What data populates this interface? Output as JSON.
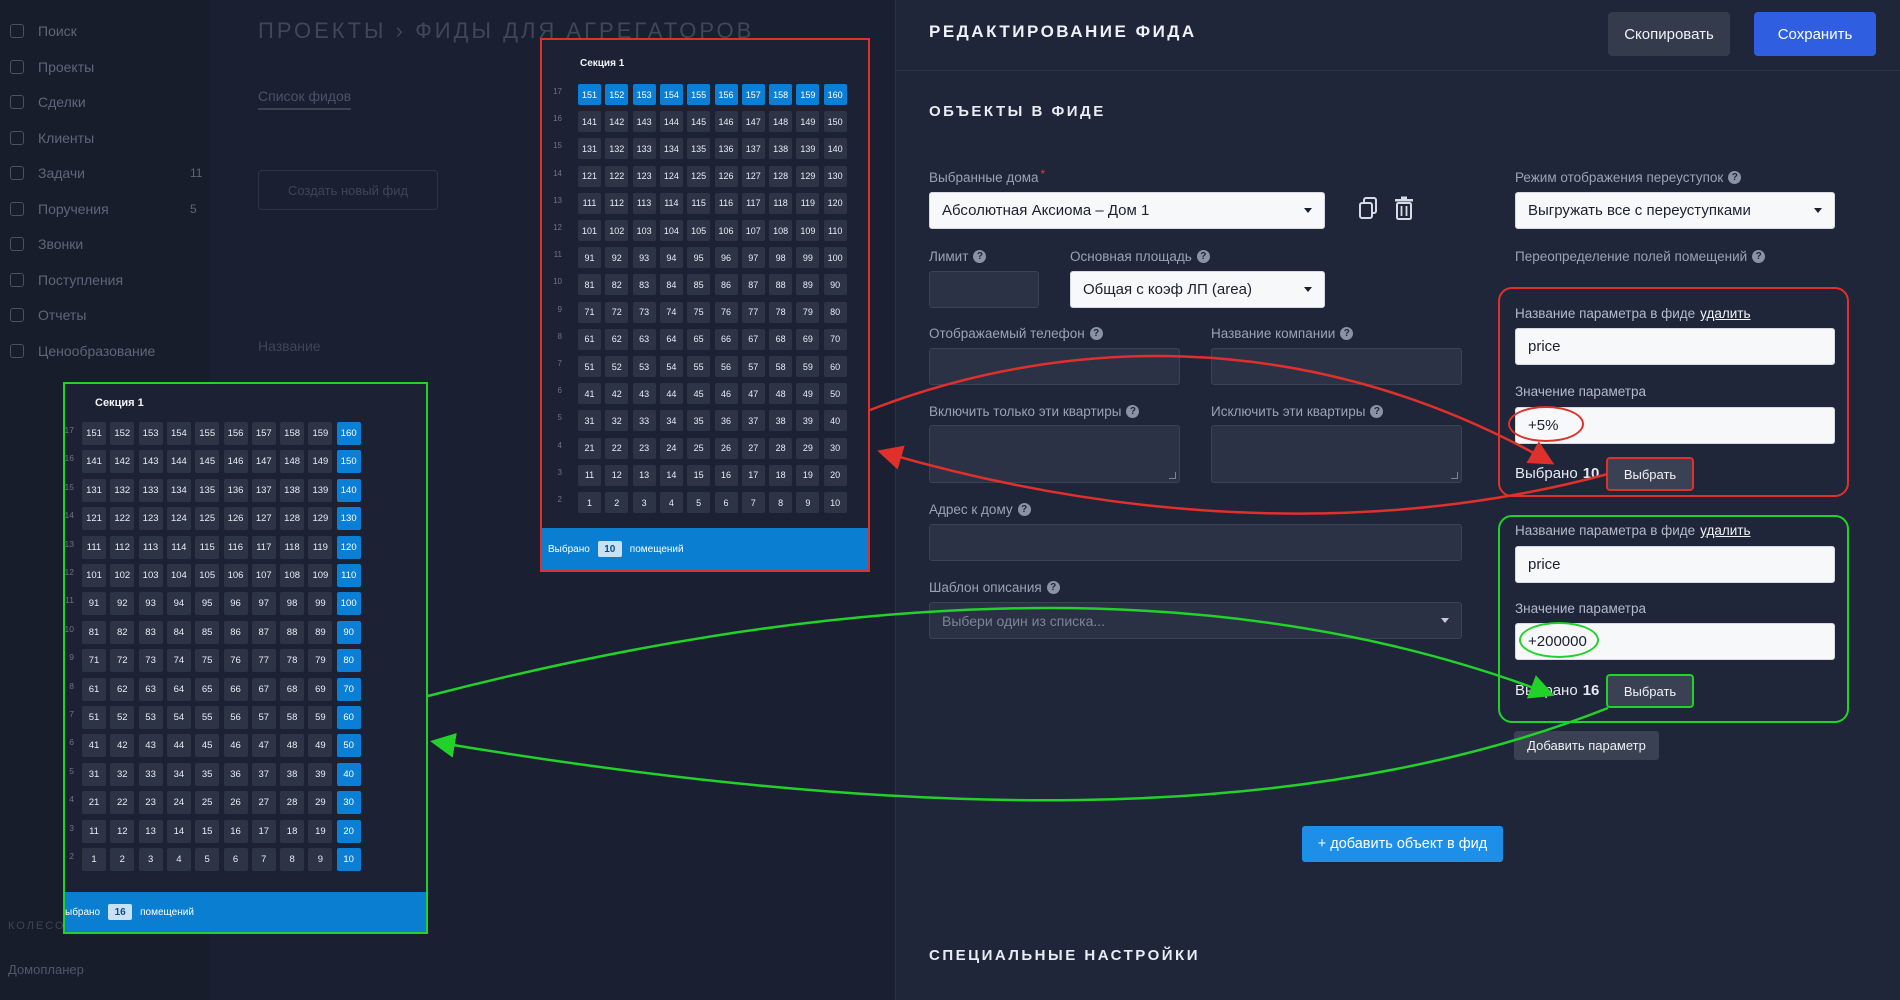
{
  "background": {
    "title": "ПРОЕКТЫ › ФИДЫ ДЛЯ АГРЕГАТОРОВ",
    "tab": "Список фидов",
    "create_button": "Создать новый фид",
    "column": "Название",
    "sidebar": [
      {
        "label": "Поиск",
        "count": ""
      },
      {
        "label": "Проекты",
        "count": ""
      },
      {
        "label": "Сделки",
        "count": ""
      },
      {
        "label": "Клиенты",
        "count": ""
      },
      {
        "label": "Задачи",
        "count": "11"
      },
      {
        "label": "Поручения",
        "count": "5"
      },
      {
        "label": "Звонки",
        "count": ""
      },
      {
        "label": "Поступления",
        "count": ""
      },
      {
        "label": "Отчеты",
        "count": ""
      },
      {
        "label": "Ценообразование",
        "count": ""
      }
    ],
    "footer": "Домоплaнер",
    "footer_section": "КОЛЕСО"
  },
  "editor": {
    "title": "РЕДАКТИРОВАНИЕ ФИДА",
    "copy_button": "Скопировать",
    "save_button": "Сохранить",
    "objects_section": "ОБЪЕКТЫ В ФИДЕ",
    "special_section": "СПЕЦИАЛЬНЫЕ НАСТРОЙКИ",
    "houses_label": "Выбранные дома",
    "houses_value": "Абсолютная Аксиома – Дом 1",
    "limit_label": "Лимит",
    "area_label": "Основная площадь",
    "area_value": "Общая с коэф ЛП (area)",
    "phone_label": "Отображаемый телефон",
    "company_label": "Название компании",
    "include_label": "Включить только эти квартиры",
    "exclude_label": "Исключить эти квартиры",
    "address_label": "Адрес к дому",
    "template_label": "Шаблон описания",
    "template_placeholder": "Выбери один из списка...",
    "resale_label": "Режим отображения переуступок",
    "resale_value": "Выгружать все с переуступками",
    "override_label": "Переопределение полей помещений",
    "param_name_label": "Название параметра в фиде",
    "delete_link": "удалить",
    "param_value_label": "Значение параметра",
    "params": [
      {
        "name": "price",
        "value": "+5%",
        "chosen_label": "Выбрано",
        "chosen_count": "10",
        "pick_button": "Выбрать"
      },
      {
        "name": "price",
        "value": "+200000",
        "chosen_label": "Выбрано",
        "chosen_count": "16",
        "pick_button": "Выбрать"
      }
    ],
    "add_param_button": "Добавить параметр",
    "add_object_button": "+ добавить объект в фид"
  },
  "grids": [
    {
      "section": "Секция 1",
      "footer_prefix": "Выбрано",
      "footer_count": "10",
      "footer_suffix": "помещений",
      "selected_rule": "top row (151–160) selected"
    },
    {
      "section": "Секция 1",
      "footer_prefix": "ыбрано",
      "footer_count": "16",
      "footer_suffix": "помещений",
      "selected_rule": "right column (10–160) selected"
    }
  ],
  "colors": {
    "accent": "#2f5fe0",
    "selected_cell": "#0b7fd6",
    "callout_red": "#e0302b",
    "callout_green": "#22d12a"
  }
}
